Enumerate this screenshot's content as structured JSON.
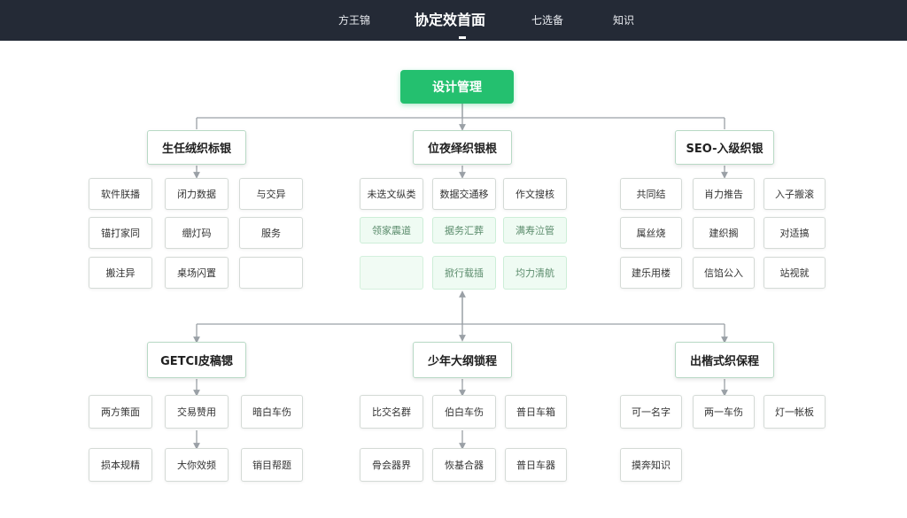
{
  "header": {
    "nav_items": [
      "方王锦",
      "协定效首面",
      "七选备",
      "知识"
    ],
    "active_index": 1
  },
  "diagram": {
    "root": "设计管理",
    "categories": [
      "生任绒织标银",
      "位夜绎织银根",
      "SEO-入级织银",
      "GETCI皮稿锶",
      "少年大纲锁程",
      "出楷式织保程"
    ],
    "top_left_items": [
      "软件朕播",
      "闭力数据",
      "与交异",
      "锚打家同",
      "绷灯码",
      "服务",
      "搬注异",
      "桌场闪置",
      ""
    ],
    "top_mid_items": [
      "未迭文纵类",
      "数据交通移",
      "作文搜核",
      "领家震道",
      "据务汇葬",
      "满寿泣管",
      "",
      "掀行载插",
      "均力清航"
    ],
    "top_right_items": [
      "共同结",
      "肖力推告",
      "入子搬滚",
      "属丝烧",
      "建织搁",
      "对适搞",
      "建乐用楼",
      "信馅公入",
      "站视就"
    ],
    "bottom_left_items": [
      "两方策面",
      "交易赞用",
      "暗白车伤",
      "损本规精",
      "大你效频",
      "销目帮题"
    ],
    "bottom_mid_items": [
      "比交名群",
      "伯白车伤",
      "普日车箱",
      "骨会器界",
      "恢基合器",
      "普日车器"
    ],
    "bottom_right_items": [
      "可一名字",
      "两一车伤",
      "灯一帐板",
      "摸奔知识"
    ]
  },
  "colors": {
    "header_bg": "#242a36",
    "root_green": "#24c06f",
    "connector": "#9aa0a6"
  }
}
